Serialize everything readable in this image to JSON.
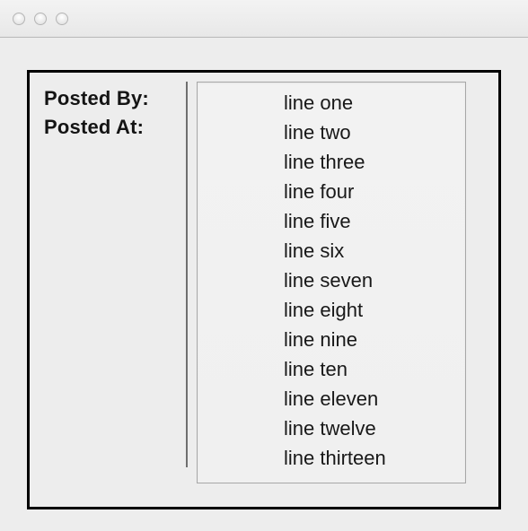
{
  "labels": {
    "posted_by": "Posted By:",
    "posted_at": "Posted At:"
  },
  "list_items": [
    "line one",
    "line two",
    "line three",
    "line four",
    "line five",
    "line six",
    "line seven",
    "line eight",
    "line nine",
    "line ten",
    "line eleven",
    "line twelve",
    "line thirteen"
  ]
}
